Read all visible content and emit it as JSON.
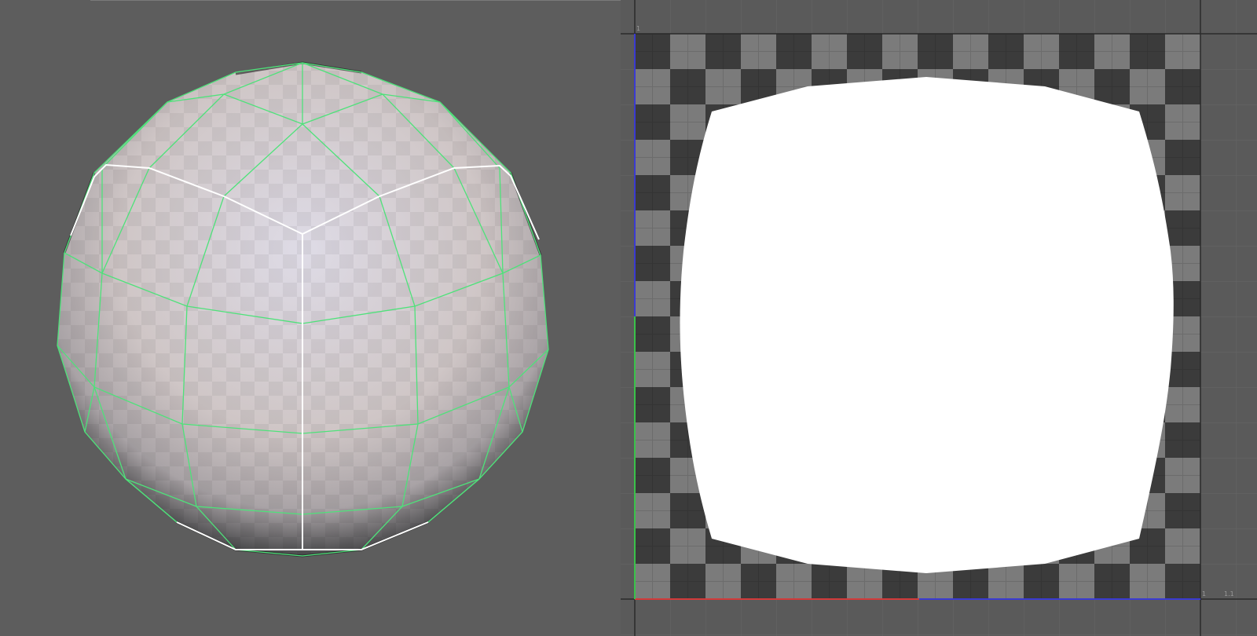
{
  "viewport": {
    "corner_label": "",
    "background": "#5d5d5d",
    "wire_color": "#4ee27a",
    "seam_color": "#ffffff"
  },
  "uv_editor": {
    "background": "#5a5a5a",
    "checker_dark": "#3b3b3b",
    "checker_light": "#7b7b7b",
    "island_fill": "#ffffff",
    "u_axis_color": "#d23a3a",
    "v_axis_color": "#3ac24a",
    "top_tick_label": "1",
    "right_tick_label": "1",
    "right_tick_label2": "1.1"
  }
}
